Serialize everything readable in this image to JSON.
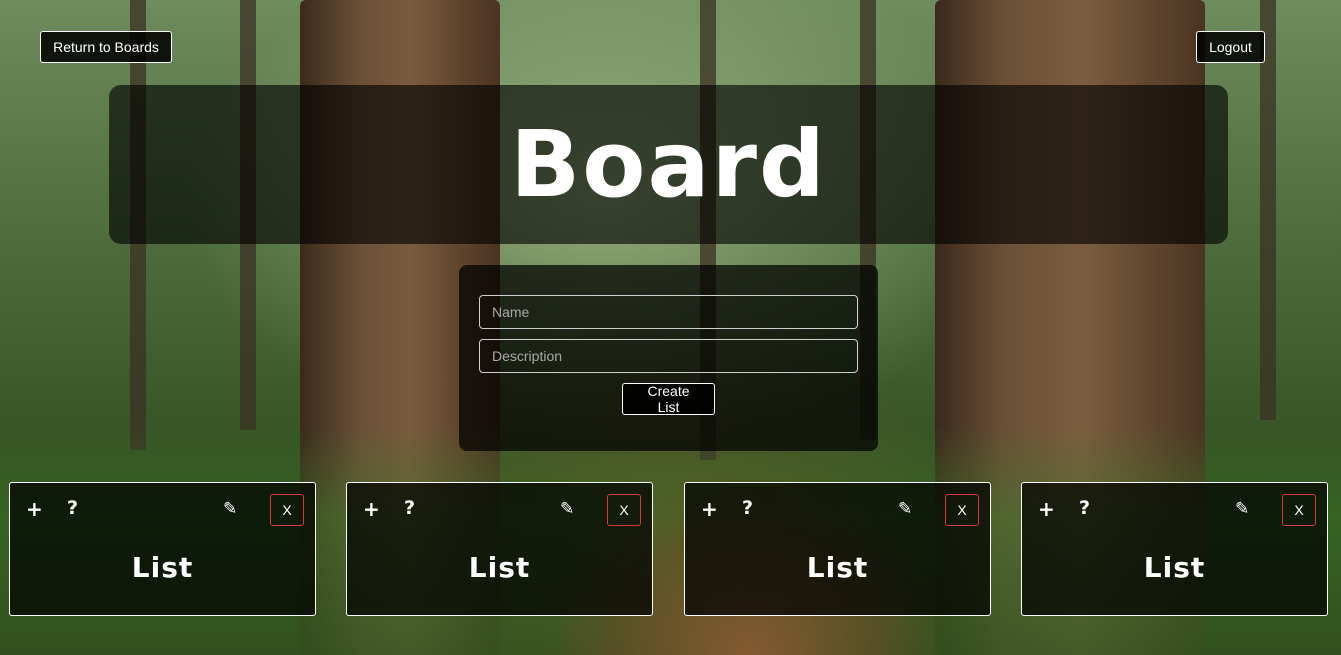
{
  "nav": {
    "return_label": "Return to Boards",
    "logout_label": "Logout"
  },
  "board": {
    "title": "Board"
  },
  "create_form": {
    "name_placeholder": "Name",
    "description_placeholder": "Description",
    "submit_label": "Create List"
  },
  "lists": [
    {
      "title": "List",
      "add_icon": "+",
      "help_icon": "?",
      "edit_icon": "✎",
      "delete_label": "X"
    },
    {
      "title": "List",
      "add_icon": "+",
      "help_icon": "?",
      "edit_icon": "✎",
      "delete_label": "X"
    },
    {
      "title": "List",
      "add_icon": "+",
      "help_icon": "?",
      "edit_icon": "✎",
      "delete_label": "X"
    },
    {
      "title": "List",
      "add_icon": "+",
      "help_icon": "?",
      "edit_icon": "✎",
      "delete_label": "X"
    }
  ],
  "icons": {
    "add": "plus-icon",
    "help": "question-icon",
    "edit": "pencil-icon"
  },
  "colors": {
    "delete_border": "#d9383a",
    "panel_bg": "#000000",
    "text": "#ffffff"
  }
}
